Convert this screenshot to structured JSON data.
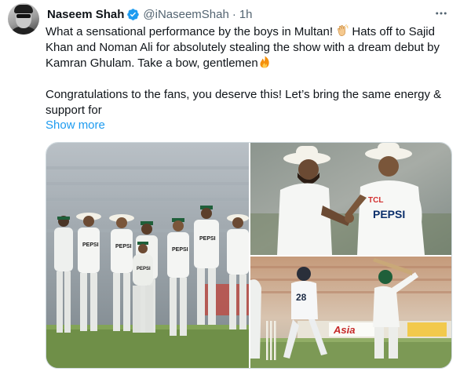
{
  "author": {
    "name": "Naseem Shah",
    "handle": "@iNaseemShah",
    "separator": "·",
    "time": "1h"
  },
  "tweet": {
    "line1_before_emoji": "What a sensational performance by the boys in Multan! ",
    "line1_after_emoji": " Hats off to Sajid Khan and Noman Ali for absolutely stealing the show with a dream debut by Kamran Ghulam. Take a bow, gentlemen",
    "paragraph2": "Congratulations to the fans, you deserve this! Let’s bring the same energy & support for",
    "show_more": "Show more"
  },
  "emojis": [
    "clapping-hands",
    "fire"
  ],
  "media": {
    "photo_count": 3,
    "photo1_jersey_text": "PEPSI",
    "photo2_jersey_text": "PEPSI",
    "photo2_sponsor_text": "TCL",
    "photo3_hoarding_text": "Asia",
    "photo3_player_number": "28"
  },
  "colors": {
    "text": "#0f1419",
    "secondary": "#536471",
    "link": "#1d9bf0",
    "verified": "#1d9bf0",
    "border": "#cfd9de"
  }
}
